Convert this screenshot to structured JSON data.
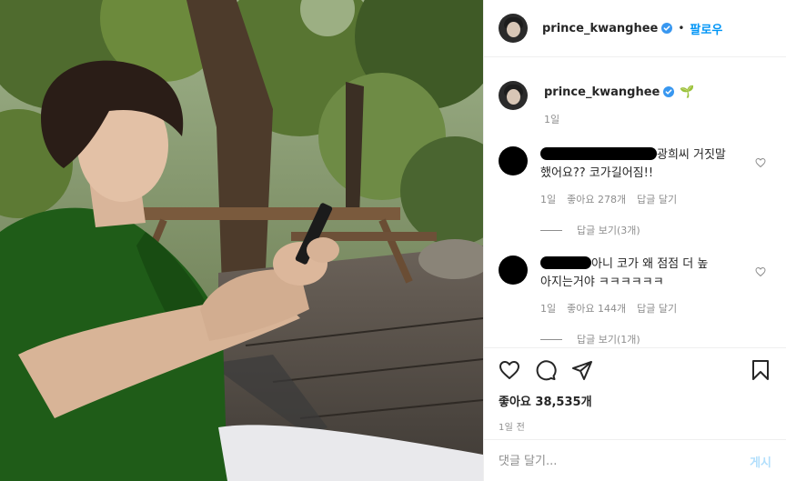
{
  "header": {
    "username": "prince_kwanghee",
    "separator": "•",
    "follow_label": "팔로우"
  },
  "caption": {
    "username": "prince_kwanghee",
    "emoji": "🌱",
    "time": "1일"
  },
  "comments": [
    {
      "text_line1": "광희씨 거짓말",
      "text_line2": "했어요?? 코가길어짐!!",
      "time": "1일",
      "likes": "좋아요 278개",
      "reply_label": "답글 달기",
      "view_replies": "답글 보기(3개)"
    },
    {
      "text_line1": "아니 코가 왜 점점 더 높",
      "text_line2": "아지는거야 ㅋㅋㅋㅋㅋㅋ",
      "time": "1일",
      "likes": "좋아요 144개",
      "reply_label": "답글 달기",
      "view_replies": "답글 보기(1개)"
    }
  ],
  "engagement": {
    "likes": "좋아요 38,535개",
    "posted": "1일 전"
  },
  "comment_box": {
    "placeholder": "댓글 달기...",
    "post_label": "게시"
  },
  "icons": {
    "like": "heart-icon",
    "comment": "comment-icon",
    "share": "share-icon",
    "save": "bookmark-icon",
    "verified": "verified-badge-icon"
  },
  "colors": {
    "accent": "#0095f6",
    "verified": "#3897f0",
    "muted": "#8e8e8e"
  }
}
